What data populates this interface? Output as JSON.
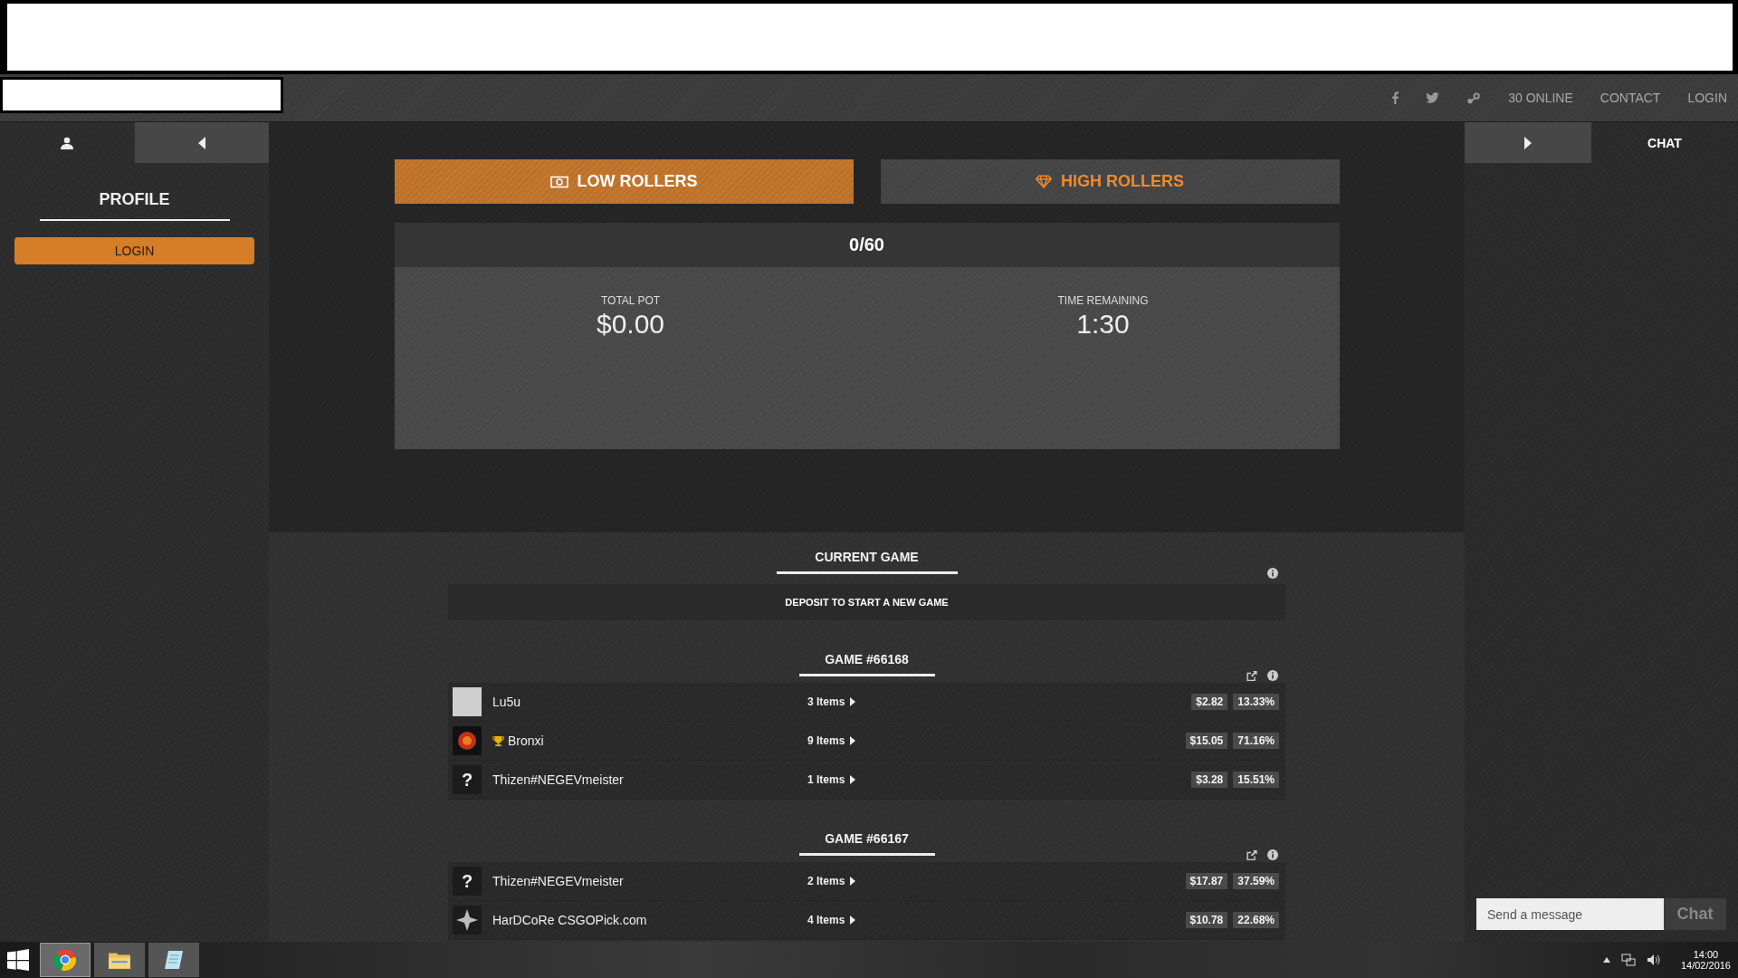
{
  "nav": {
    "links": [
      "30 ONLINE",
      "CONTACT",
      "LOGIN"
    ]
  },
  "left_panel": {
    "tabs": [
      {
        "kind": "profile",
        "selected": true
      },
      {
        "kind": "collapse",
        "selected": false
      }
    ],
    "title": "PROFILE",
    "login_button": "LOGIN"
  },
  "rooms": [
    {
      "kind": "money",
      "label": "LOW ROLLERS",
      "selected": true
    },
    {
      "kind": "diamond",
      "label": "HIGH ROLLERS",
      "selected": false
    }
  ],
  "jackpot": {
    "count": "0/60",
    "stats": [
      {
        "label": "TOTAL POT",
        "value": "$0.00"
      },
      {
        "label": "TIME REMAINING",
        "value": "1:30"
      }
    ]
  },
  "current_game": {
    "title": "CURRENT GAME",
    "message": "DEPOSIT TO START A NEW GAME"
  },
  "games": [
    {
      "title": "GAME #66168",
      "players": [
        {
          "avatar": {
            "kind": "photo"
          },
          "winner": false,
          "name": "Lu5u",
          "items": "3 Items",
          "value": "$2.82",
          "chance": "13.33%"
        },
        {
          "avatar": {
            "kind": "emblem"
          },
          "winner": true,
          "name": "Bronxi",
          "items": "9 Items",
          "value": "$15.05",
          "chance": "71.16%"
        },
        {
          "avatar": {
            "kind": "unknown",
            "text": "?"
          },
          "winner": false,
          "name": "Thizen#NEGEVmeister",
          "items": "1 Items",
          "value": "$3.28",
          "chance": "15.51%"
        }
      ]
    },
    {
      "title": "GAME #66167",
      "players": [
        {
          "avatar": {
            "kind": "unknown",
            "text": "?"
          },
          "winner": false,
          "name": "Thizen#NEGEVmeister",
          "items": "2 Items",
          "value": "$17.87",
          "chance": "37.59%"
        },
        {
          "avatar": {
            "kind": "star"
          },
          "winner": false,
          "name": "HarDCoRe CSGOPick.com",
          "items": "4 Items",
          "value": "$10.78",
          "chance": "22.68%"
        }
      ]
    }
  ],
  "chat": {
    "tabs": [
      {
        "kind": "expand",
        "selected": false
      },
      {
        "kind": "chat",
        "label": "CHAT",
        "selected": true
      }
    ],
    "placeholder": "Send a message",
    "send_button": "Chat"
  },
  "taskbar": {
    "apps": [
      {
        "kind": "browser",
        "selected": true
      },
      {
        "kind": "folder",
        "selected": false
      },
      {
        "kind": "notes",
        "selected": false
      }
    ],
    "time": "14:00",
    "date": "14/02/2016"
  }
}
